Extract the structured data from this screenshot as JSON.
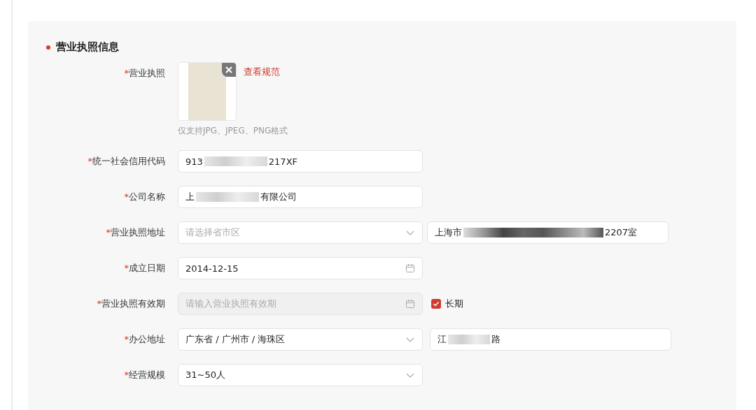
{
  "section": {
    "title": "营业执照信息"
  },
  "rows": [
    {
      "kind": "upload",
      "mark": "*",
      "label": "营业执照",
      "link": "查看规范",
      "hint": "仅支持JPG、JPEG、PNG格式"
    },
    {
      "kind": "text",
      "mark": "*",
      "label": "统一社会信用代码",
      "value_start": "913",
      "value_end": "217XF"
    },
    {
      "kind": "text",
      "mark": "*",
      "label": "公司名称",
      "value_start": "上",
      "value_end": "有限公司"
    },
    {
      "kind": "region_address",
      "mark": "*",
      "label": "营业执照地址",
      "select": {
        "placeholder": "请选择省市区"
      },
      "detail": {
        "value_start": "上海市",
        "value_end": "2207室"
      }
    },
    {
      "kind": "date",
      "mark": "*",
      "label": "成立日期",
      "value": "2014-12-15",
      "disabled": false
    },
    {
      "kind": "date",
      "mark": "*",
      "label": "营业执照有效期",
      "placeholder": "请输入营业执照有效期",
      "disabled": true,
      "checkbox": {
        "label": "长期",
        "checked": true
      }
    },
    {
      "kind": "region_address",
      "mark": "*",
      "label": "办公地址",
      "select": {
        "value": "广东省 / 广州市 / 海珠区"
      },
      "detail": {
        "value_start": "江",
        "value_end": "路"
      }
    },
    {
      "kind": "select",
      "mark": "*",
      "label": "经营规模",
      "value": "31~50人"
    }
  ]
}
